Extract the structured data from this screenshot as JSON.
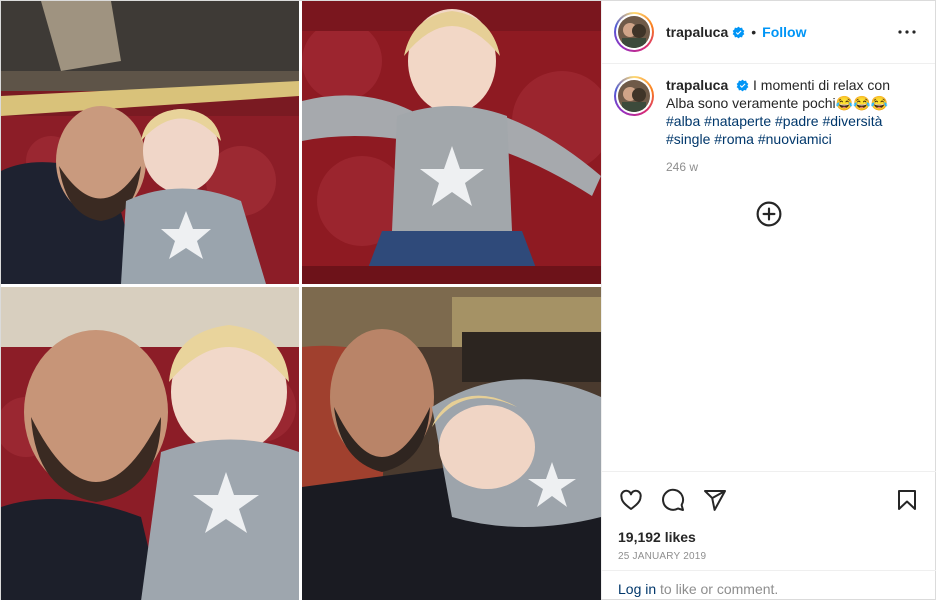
{
  "post": {
    "username": "trapaluca",
    "follow_label": "Follow",
    "separator": "•",
    "caption_text": "I momenti di relax con Alba sono veramente pochi😂😂😂",
    "hashtags": [
      "#alba",
      "#nataperte",
      "#padre",
      "#diversità",
      "#single",
      "#roma",
      "#nuoviamici"
    ],
    "time_ago": "246 w",
    "likes": "19,192 likes",
    "date": "25 JANUARY 2019",
    "login_link": "Log in",
    "login_rest": " to like or comment."
  },
  "icons": {
    "verified": "verified-badge-icon",
    "more": "more-options-icon",
    "add": "add-circle-icon",
    "like": "heart-icon",
    "comment": "comment-icon",
    "share": "share-icon",
    "save": "bookmark-icon"
  },
  "colors": {
    "accent": "#0095f6",
    "link": "#00376b",
    "muted": "#8e8e8e",
    "text": "#262626",
    "border": "#efefef",
    "velvet": "#8e1a22"
  }
}
